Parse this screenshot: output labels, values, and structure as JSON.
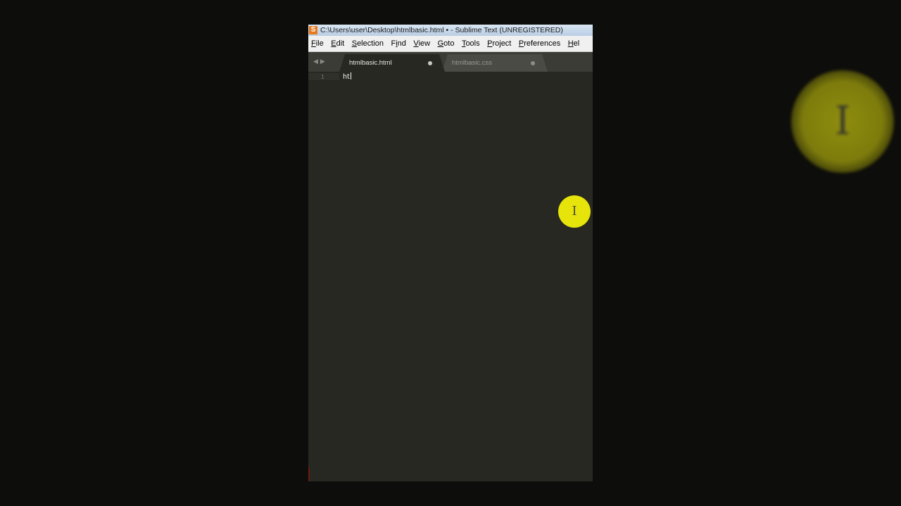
{
  "window": {
    "title": "C:\\Users\\user\\Desktop\\htmlbasic.html • - Sublime Text (UNREGISTERED)",
    "app_icon_glyph": "S",
    "app_icon_color": "#e87a1d"
  },
  "menubar": {
    "items": [
      {
        "first": "F",
        "rest": "ile"
      },
      {
        "first": "E",
        "rest": "dit"
      },
      {
        "first": "S",
        "rest": "election"
      },
      {
        "first": "F",
        "rest": "i",
        "pre": "",
        "full_note": "Find"
      },
      {
        "first": "V",
        "rest": "iew"
      },
      {
        "first": "G",
        "rest": "oto"
      },
      {
        "first": "T",
        "rest": "ools"
      },
      {
        "first": "P",
        "rest": "roject"
      },
      {
        "first": "P",
        "rest": "references"
      },
      {
        "first": "H",
        "rest": "el"
      }
    ]
  },
  "tabs": {
    "nav_icons": [
      "left-arrow-icon",
      "right-arrow-icon"
    ],
    "items": [
      {
        "label": "htmlbasic.html",
        "active": true,
        "dirty": true
      },
      {
        "label": "htmlbasic.css",
        "active": false,
        "dirty": true
      }
    ]
  },
  "editor": {
    "lines": [
      {
        "number": "1",
        "text": "ht"
      }
    ],
    "theme": {
      "background": "#272822",
      "foreground": "#f8f8f2"
    }
  },
  "overlay": {
    "cursor_highlight_color": "#e6e40a",
    "cursor_icon": "text-cursor-icon"
  }
}
